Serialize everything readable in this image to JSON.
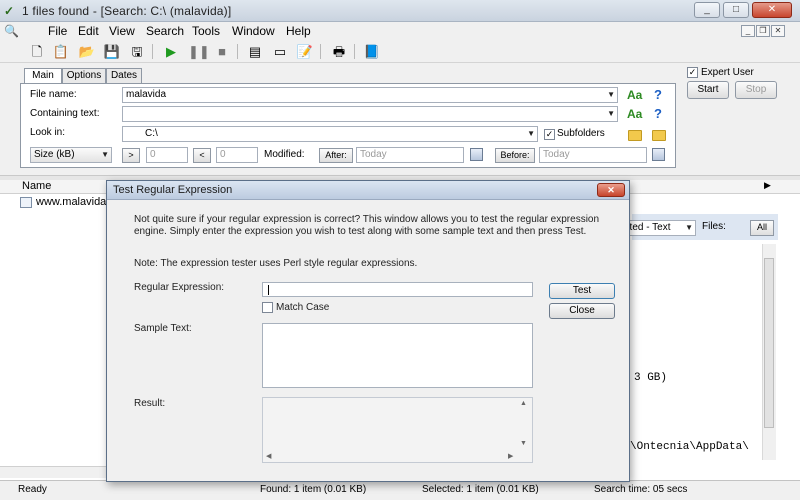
{
  "window": {
    "title": "1 files found - [Search: C:\\ (malavida)]",
    "controls": [
      "_",
      "□",
      "✕"
    ]
  },
  "menu": [
    "File",
    "Edit",
    "View",
    "Search",
    "Tools",
    "Window",
    "Help"
  ],
  "tabs": [
    "Main",
    "Options",
    "Dates"
  ],
  "main": {
    "file_name_label": "File name:",
    "file_name_value": "malavida",
    "containing_text_label": "Containing text:",
    "containing_text_value": "",
    "look_in_label": "Look in:",
    "look_in_value": "C:\\",
    "subfolders_label": "Subfolders",
    "subfolders_checked": true,
    "case_label": "Aa",
    "help_label": "?",
    "size_select": "Size (kB)",
    "gt_label": ">",
    "gt_value": "0",
    "lt_label": "<",
    "lt_value": "0",
    "modified_label": "Modified:",
    "after_label": "After:",
    "after_value": "Today",
    "before_label": "Before:",
    "before_value": "Today"
  },
  "side": {
    "expert_user_label": "Expert User",
    "expert_user_checked": true,
    "start_label": "Start",
    "stop_label": "Stop"
  },
  "results": {
    "name_header": "Name",
    "row_name": "www.malavida",
    "preview_mode": "ated - Text",
    "files_label": "Files:",
    "files_value": "All",
    "preview_line_1": "3 GB)",
    "preview_line_2": "\\Ontecnia\\AppData\\"
  },
  "dialog": {
    "title": "Test Regular Expression",
    "close_label": "✕",
    "intro": "Not quite sure if your regular expression is correct? This window allows you to test the regular expression engine. Simply enter the expression you wish to test along with some sample text and then press Test.",
    "note": "Note: The expression tester uses Perl style regular expressions.",
    "regex_label": "Regular Expression:",
    "regex_value": "",
    "match_case_label": "Match Case",
    "match_case_checked": false,
    "sample_label": "Sample Text:",
    "sample_value": "",
    "result_label": "Result:",
    "result_value": "",
    "test_label": "Test",
    "close_button_label": "Close"
  },
  "status": {
    "ready": "Ready",
    "found": "Found: 1 item (0.01 KB)",
    "selected": "Selected: 1 item (0.01 KB)",
    "search_time": "Search time: 05 secs"
  }
}
